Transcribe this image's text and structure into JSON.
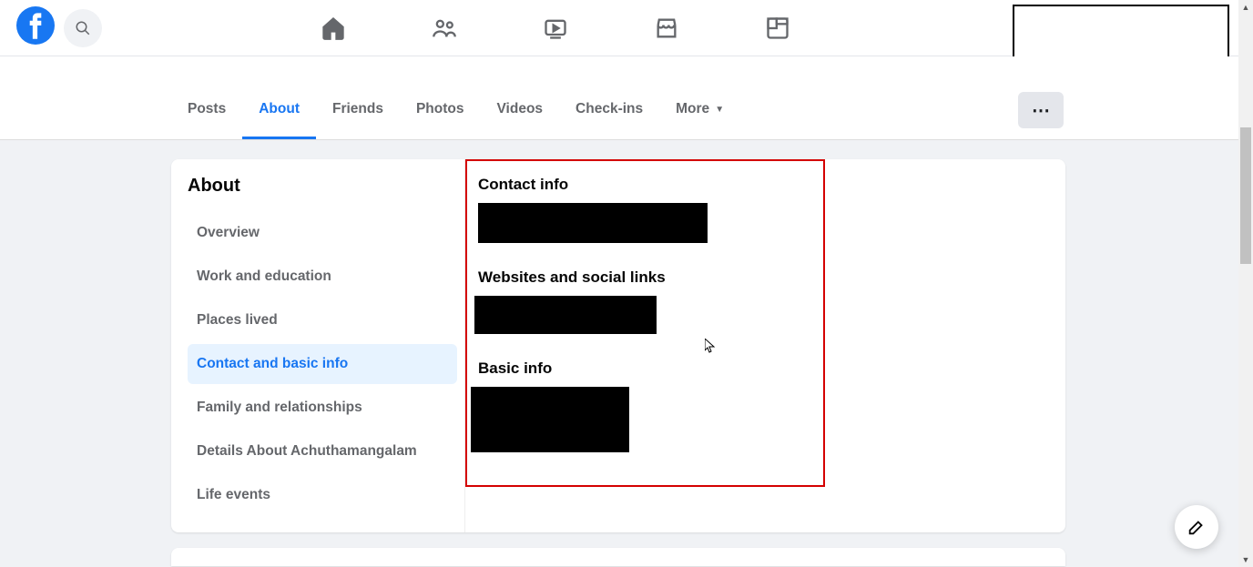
{
  "tabs": {
    "posts": "Posts",
    "about": "About",
    "friends": "Friends",
    "photos": "Photos",
    "videos": "Videos",
    "checkins": "Check-ins",
    "more": "More"
  },
  "sidebar": {
    "title": "About",
    "items": {
      "overview": "Overview",
      "work": "Work and education",
      "places": "Places lived",
      "contact": "Contact and basic info",
      "family": "Family and relationships",
      "details": "Details About Achuthamangalam",
      "life": "Life events"
    }
  },
  "sections": {
    "contact": "Contact info",
    "websites": "Websites and social links",
    "basic": "Basic info"
  }
}
